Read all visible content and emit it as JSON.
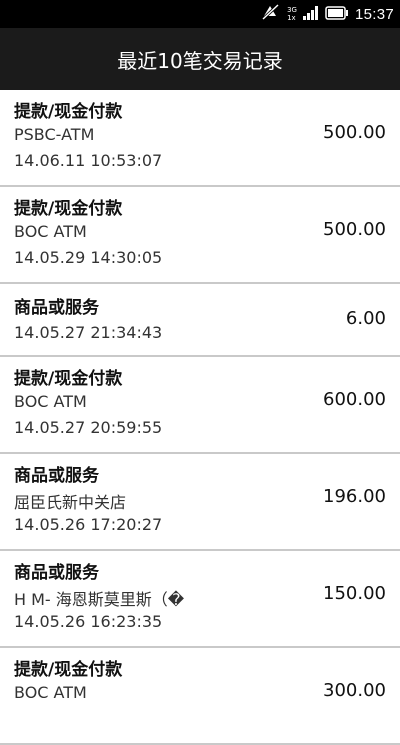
{
  "status_bar": {
    "time": "15:37",
    "network_top": "3G",
    "network_bottom": "1x",
    "icons": [
      "muted-icon",
      "signal-icon",
      "battery-icon"
    ]
  },
  "header": {
    "title": "最近10笔交易记录"
  },
  "transactions": [
    {
      "type": "提款/现金付款",
      "merchant": "PSBC-ATM",
      "time": "14.06.11 10:53:07",
      "amount": "500.00"
    },
    {
      "type": "提款/现金付款",
      "merchant": "BOC ATM",
      "time": "14.05.29 14:30:05",
      "amount": "500.00"
    },
    {
      "type": "商品或服务",
      "merchant": "",
      "time": "14.05.27 21:34:43",
      "amount": "6.00"
    },
    {
      "type": "提款/现金付款",
      "merchant": "BOC ATM",
      "time": "14.05.27 20:59:55",
      "amount": "600.00"
    },
    {
      "type": "商品或服务",
      "merchant": "屈臣氏新中关店",
      "time": "14.05.26 17:20:27",
      "amount": "196.00"
    },
    {
      "type": "商品或服务",
      "merchant": "H M- 海恩斯莫里斯（�",
      "time": "14.05.26 16:23:35",
      "amount": "150.00"
    },
    {
      "type": "提款/现金付款",
      "merchant": "BOC ATM",
      "time": "",
      "amount": "300.00"
    }
  ],
  "colors": {
    "status_bar": "#000000",
    "header": "#1b1b1b",
    "divider": "#c9c9c9"
  }
}
